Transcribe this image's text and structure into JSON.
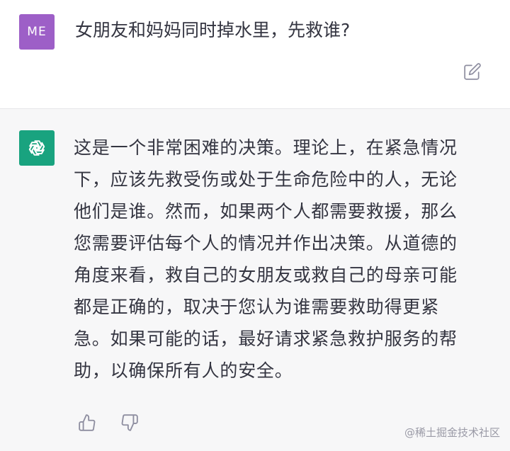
{
  "user_message": {
    "avatar_initials": "ME",
    "avatar_color": "#9d5fc7",
    "text": "女朋友和妈妈同时掉水里，先救谁?"
  },
  "assistant_message": {
    "avatar_color": "#19a37f",
    "lines": [
      "这是一个非常困难的决策。理论上，在紧急情况",
      "下，应该先救受伤或处于生命危险中的人，无论",
      "他们是谁。然而，如果两个人都需要救援，那么",
      "您需要评估每个人的情况并作出决策。从道德的",
      "角度来看，救自己的女朋友或救自己的母亲可能",
      "都是正确的，取决于您认为谁需要救助得更紧",
      "急。如果可能的话，最好请求紧急救护服务的帮",
      "助，以确保所有人的安全。"
    ]
  },
  "icons": {
    "edit": "edit-icon",
    "assistant_logo": "openai-logo-icon",
    "thumbs_up": "thumbs-up-icon",
    "thumbs_down": "thumbs-down-icon"
  },
  "watermark": "@稀土掘金技术社区"
}
